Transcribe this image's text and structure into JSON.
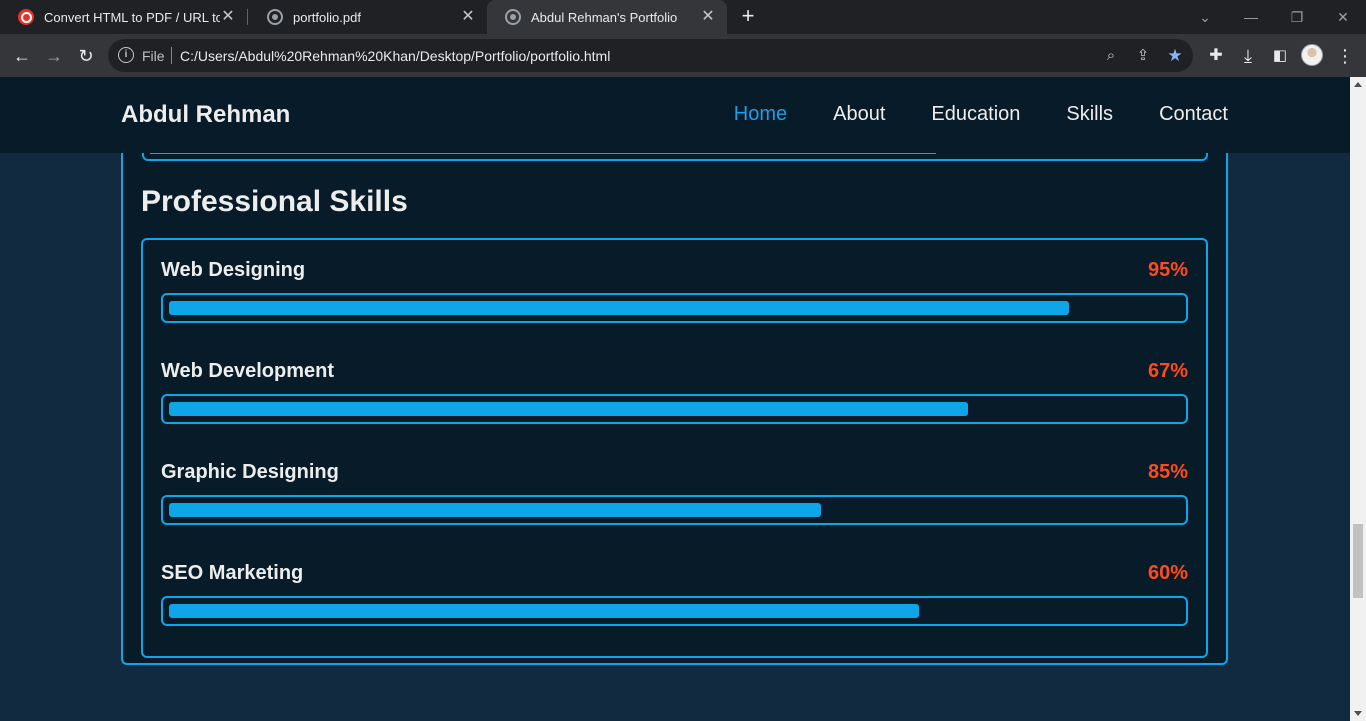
{
  "browser": {
    "tabs": [
      {
        "title": "Convert HTML to PDF / URL to PI",
        "icon": "ilovepdf-icon",
        "active": false
      },
      {
        "title": "portfolio.pdf",
        "icon": "globe-icon",
        "active": false
      },
      {
        "title": "Abdul Rehman's Portfolio",
        "icon": "globe-icon",
        "active": true
      }
    ],
    "address": {
      "scheme_label": "File",
      "url": "C:/Users/Abdul%20Rehman%20Khan/Desktop/Portfolio/portfolio.html"
    }
  },
  "site": {
    "logo": "Abdul Rehman",
    "nav": [
      {
        "label": "Home",
        "active": true
      },
      {
        "label": "About",
        "active": false
      },
      {
        "label": "Education",
        "active": false
      },
      {
        "label": "Skills",
        "active": false
      },
      {
        "label": "Contact",
        "active": false
      }
    ],
    "section_title": "Professional Skills",
    "skills": [
      {
        "name": "Web Designing",
        "percent_label": "95%",
        "fill_fraction": 0.89
      },
      {
        "name": "Web Development",
        "percent_label": "67%",
        "fill_fraction": 0.79
      },
      {
        "name": "Graphic Designing",
        "percent_label": "85%",
        "fill_fraction": 0.645
      },
      {
        "name": "SEO Marketing",
        "percent_label": "60%",
        "fill_fraction": 0.742
      }
    ]
  },
  "colors": {
    "accent": "#0ea5e9",
    "percent": "#ff4a1c",
    "header_bg": "#081b29",
    "page_bg": "#122a40",
    "text": "#ededed"
  }
}
